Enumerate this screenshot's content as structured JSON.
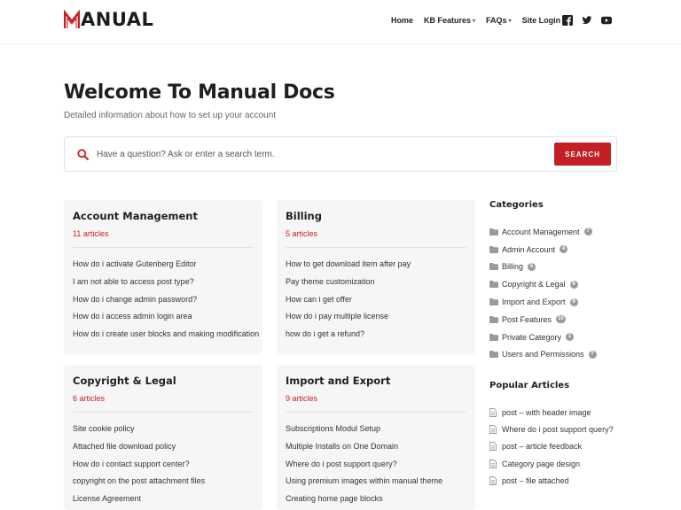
{
  "brand": {
    "logo_text": "ANUAL",
    "logo_letter": "M",
    "accent": "#c41f24"
  },
  "nav": {
    "items": [
      {
        "label": "Home",
        "has_caret": false
      },
      {
        "label": "KB Features",
        "has_caret": true
      },
      {
        "label": "FAQs",
        "has_caret": true
      },
      {
        "label": "Site Login",
        "has_caret": false
      }
    ],
    "caret": "⌄",
    "social": [
      "facebook-icon",
      "twitter-icon",
      "youtube-icon"
    ]
  },
  "hero": {
    "title": "Welcome To Manual Docs",
    "subtitle": "Detailed information about how to set up your account"
  },
  "search": {
    "placeholder": "Have a question? Ask or enter a search term.",
    "button_label": "SEARCH",
    "icon": "search-icon"
  },
  "cards": [
    {
      "title": "Account Management",
      "count": "11 articles",
      "articles": [
        "How do i activate Gutenberg Editor",
        "I am not able to access post type?",
        "How do i change admin password?",
        "How do i access admin login area",
        "How do i create user blocks and making modification"
      ]
    },
    {
      "title": "Billing",
      "count": "5 articles",
      "articles": [
        "How to get download item after pay",
        "Pay theme customization",
        "How can i get offer",
        "How do i pay multiple license",
        "how do i get a refund?"
      ]
    },
    {
      "title": "Copyright & Legal",
      "count": "6 articles",
      "articles": [
        "Site cookie policy",
        "Attached file download policy",
        "How do i contact support center?",
        "copyright on the post attachment files",
        "License Agreement"
      ]
    },
    {
      "title": "Import and Export",
      "count": "9 articles",
      "articles": [
        "Subscriptions Modul Setup",
        "Multiple Installs on One Domain",
        "Where do i post support query?",
        "Using premium images within manual theme",
        "Creating home page blocks"
      ]
    }
  ],
  "sidebar": {
    "categories_title": "Categories",
    "categories": [
      {
        "label": "Account Management",
        "count": "7"
      },
      {
        "label": "Admin Account",
        "count": "4"
      },
      {
        "label": "Billing",
        "count": "5"
      },
      {
        "label": "Copyright & Legal",
        "count": "6"
      },
      {
        "label": "Import and Export",
        "count": "9"
      },
      {
        "label": "Post Features",
        "count": "10"
      },
      {
        "label": "Private Category",
        "count": "1"
      },
      {
        "label": "Users and Permissions",
        "count": "7"
      }
    ],
    "popular_title": "Popular Articles",
    "popular": [
      "post – with header image",
      "Where do i post support query?",
      "post – article feedback",
      "Category page design",
      "post – file attached"
    ]
  }
}
